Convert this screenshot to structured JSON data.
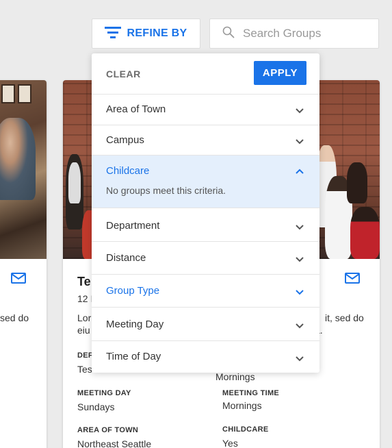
{
  "toolbar": {
    "refine_label": "REFINE BY",
    "search_placeholder": "Search Groups",
    "accent_color": "#1a73e8"
  },
  "filters": {
    "clear_label": "CLEAR",
    "apply_label": "APPLY",
    "items": [
      {
        "label": "Area of Town",
        "state": "collapsed"
      },
      {
        "label": "Campus",
        "state": "collapsed"
      },
      {
        "label": "Childcare",
        "state": "expanded",
        "message": "No groups meet this criteria."
      },
      {
        "label": "Department",
        "state": "collapsed"
      },
      {
        "label": "Distance",
        "state": "collapsed"
      },
      {
        "label": "Group Type",
        "state": "active"
      },
      {
        "label": "Meeting Day",
        "state": "collapsed"
      },
      {
        "label": "Time of Day",
        "state": "collapsed"
      }
    ]
  },
  "left_card": {
    "text": "sed do"
  },
  "main_card": {
    "title_fragment": "Te",
    "subtitle_fragment": "12 I",
    "desc_left_line1": "Lor",
    "desc_left_line2": "eiu",
    "desc_right_line1": "it, sed do",
    "desc_right_line2": "a.",
    "department_label_fragment": "DEF",
    "department_value_fragment": "Tes",
    "time_of_day_value": "Mornings",
    "meeting_day_label": "MEETING DAY",
    "meeting_day_value": "Sundays",
    "meeting_time_label": "MEETING TIME",
    "meeting_time_value": "Mornings",
    "area_label": "AREA OF TOWN",
    "area_value": "Northeast Seattle",
    "childcare_label": "CHILDCARE",
    "childcare_value": "Yes"
  }
}
